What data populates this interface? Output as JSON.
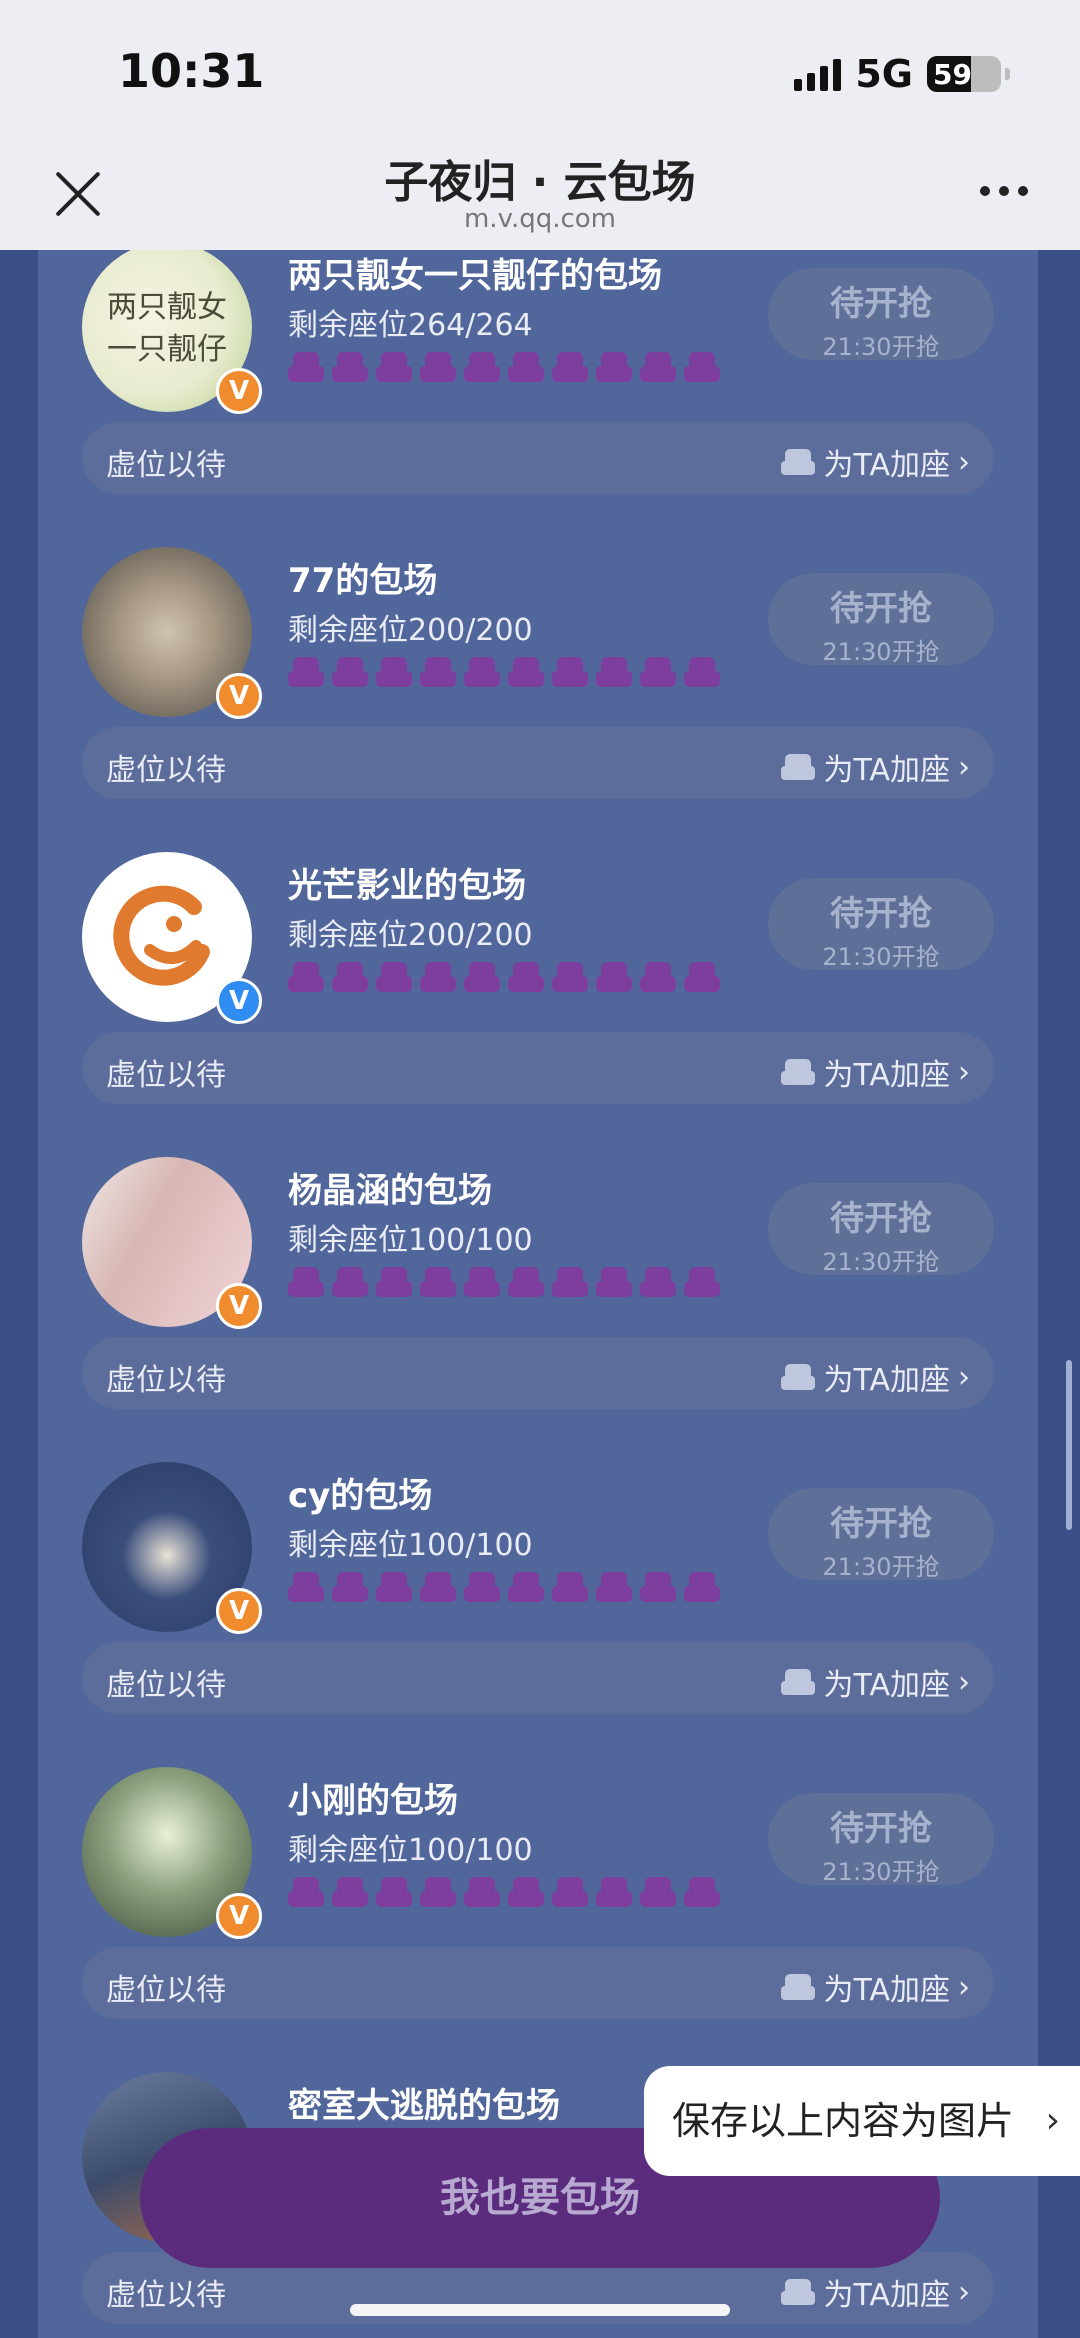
{
  "status_bar": {
    "time": "10:31",
    "network": "5G",
    "battery": "59",
    "battery_level_percent": 59
  },
  "header": {
    "title": "子夜归 · 云包场",
    "subtitle": "m.v.qq.com"
  },
  "cards": [
    {
      "name": "两只靓女一只靓仔的包场",
      "seats": "剩余座位264/264",
      "status": "待开抢",
      "time": "21:30开抢",
      "bar_left": "虚位以待",
      "bar_right": "为TA加座",
      "avatar_text_1": "两只靓女",
      "avatar_text_2": "一只靓仔"
    },
    {
      "name": "77的包场",
      "seats": "剩余座位200/200",
      "status": "待开抢",
      "time": "21:30开抢",
      "bar_left": "虚位以待",
      "bar_right": "为TA加座"
    },
    {
      "name": "光芒影业的包场",
      "seats": "剩余座位200/200",
      "status": "待开抢",
      "time": "21:30开抢",
      "bar_left": "虚位以待",
      "bar_right": "为TA加座"
    },
    {
      "name": "杨晶涵的包场",
      "seats": "剩余座位100/100",
      "status": "待开抢",
      "time": "21:30开抢",
      "bar_left": "虚位以待",
      "bar_right": "为TA加座"
    },
    {
      "name": "cy的包场",
      "seats": "剩余座位100/100",
      "status": "待开抢",
      "time": "21:30开抢",
      "bar_left": "虚位以待",
      "bar_right": "为TA加座"
    },
    {
      "name": "小刚的包场",
      "seats": "剩余座位100/100",
      "status": "待开抢",
      "time": "21:30开抢",
      "bar_left": "虚位以待",
      "bar_right": "为TA加座"
    },
    {
      "name": "密室大逃脱的包场",
      "bar_left": "虚位以待",
      "bar_right": "为TA加座"
    }
  ],
  "verify_badge": "V",
  "cta": {
    "label": "我也要包场"
  },
  "save_pill": {
    "label": "保存以上内容为图片"
  },
  "icons": {
    "close": "close-icon",
    "more": "more-icon",
    "seat": "seat-icon",
    "chevron": "chevron-right-icon",
    "verified": "verified-badge-icon"
  }
}
